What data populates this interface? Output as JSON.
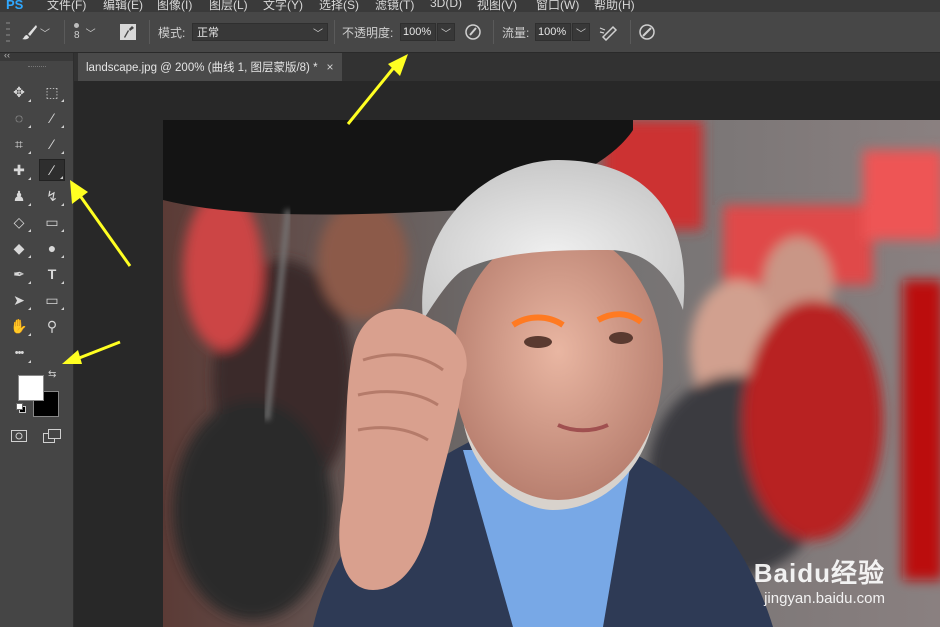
{
  "app": {
    "logo": "PS"
  },
  "menu": [
    "文件(F)",
    "编辑(E)",
    "图像(I)",
    "图层(L)",
    "文字(Y)",
    "选择(S)",
    "滤镜(T)",
    "3D(D)",
    "视图(V)",
    "窗口(W)",
    "帮助(H)"
  ],
  "options": {
    "brush_size": "8",
    "mode_label": "模式:",
    "mode_value": "正常",
    "opacity_label": "不透明度:",
    "opacity_value": "100%",
    "flow_label": "流量:",
    "flow_value": "100%"
  },
  "document": {
    "tab_title": "landscape.jpg @ 200% (曲线 1, 图层蒙版/8) *",
    "close": "×"
  },
  "tools": [
    {
      "name": "move-tool-icon",
      "glyph": "✥"
    },
    {
      "name": "marquee-tool-icon",
      "glyph": "⬚"
    },
    {
      "name": "lasso-tool-icon",
      "glyph": "◌"
    },
    {
      "name": "quick-select-tool-icon",
      "glyph": "⁄"
    },
    {
      "name": "crop-tool-icon",
      "glyph": "⌗"
    },
    {
      "name": "eyedropper-tool-icon",
      "glyph": "⁄"
    },
    {
      "name": "healing-brush-tool-icon",
      "glyph": "✚"
    },
    {
      "name": "brush-tool-icon",
      "glyph": "∕"
    },
    {
      "name": "stamp-tool-icon",
      "glyph": "♟"
    },
    {
      "name": "history-brush-tool-icon",
      "glyph": "↯"
    },
    {
      "name": "eraser-tool-icon",
      "glyph": "◇"
    },
    {
      "name": "gradient-tool-icon",
      "glyph": "▭"
    },
    {
      "name": "blur-tool-icon",
      "glyph": "◆"
    },
    {
      "name": "dodge-tool-icon",
      "glyph": "●"
    },
    {
      "name": "pen-tool-icon",
      "glyph": "✒"
    },
    {
      "name": "type-tool-icon",
      "glyph": "T"
    },
    {
      "name": "path-select-tool-icon",
      "glyph": "➤"
    },
    {
      "name": "shape-tool-icon",
      "glyph": "▭"
    },
    {
      "name": "hand-tool-icon",
      "glyph": "✋"
    },
    {
      "name": "zoom-tool-icon",
      "glyph": "⚲"
    },
    {
      "name": "more-tools-icon",
      "glyph": "•••"
    }
  ],
  "colors": {
    "foreground": "#ffffff",
    "background": "#000000",
    "arrow": "#ffff22"
  },
  "watermark": {
    "main": "Baidu经验",
    "sub": "jingyan.baidu.com"
  }
}
